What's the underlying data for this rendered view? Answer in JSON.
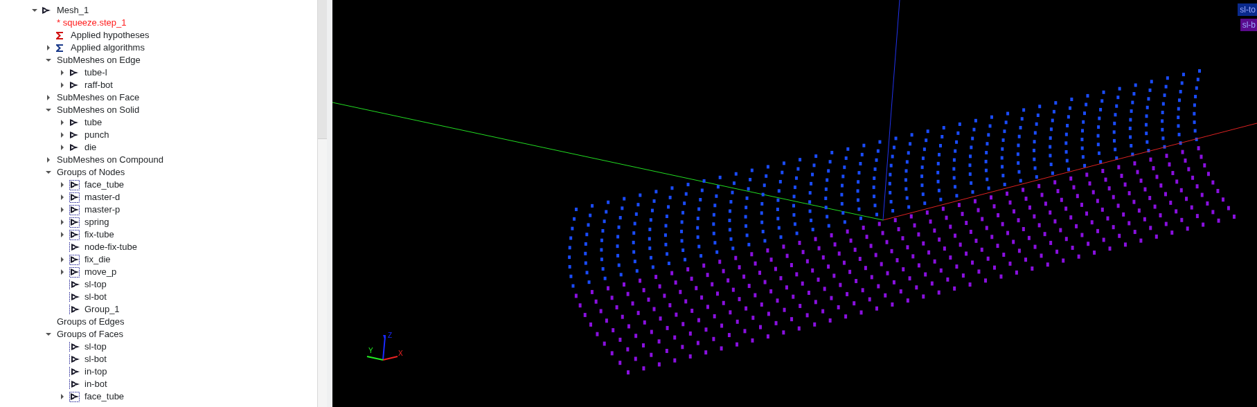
{
  "tree": [
    {
      "label": "Mesh_1",
      "kind": "mesh",
      "expanded": true,
      "children": [
        {
          "label": "* squeeze.step_1",
          "kind": "modified"
        },
        {
          "label": "Applied hypotheses",
          "kind": "hypothesis"
        },
        {
          "label": "Applied algorithms",
          "kind": "algorithm",
          "expanded": false
        },
        {
          "label": "SubMeshes on Edge",
          "kind": "folder",
          "expanded": true,
          "children": [
            {
              "label": "tube-l",
              "kind": "mesh",
              "expanded": false
            },
            {
              "label": "raff-bot",
              "kind": "mesh",
              "expanded": false
            }
          ]
        },
        {
          "label": "SubMeshes on Face",
          "kind": "folder",
          "expanded": false
        },
        {
          "label": "SubMeshes on Solid",
          "kind": "folder",
          "expanded": true,
          "children": [
            {
              "label": "tube",
              "kind": "mesh",
              "expanded": false
            },
            {
              "label": "punch",
              "kind": "mesh",
              "expanded": false
            },
            {
              "label": "die",
              "kind": "mesh",
              "expanded": false
            }
          ]
        },
        {
          "label": "SubMeshes on Compound",
          "kind": "folder",
          "expanded": false
        },
        {
          "label": "Groups of Nodes",
          "kind": "folder",
          "expanded": true,
          "children": [
            {
              "label": "face_tube",
              "kind": "group",
              "expanded": false
            },
            {
              "label": "master-d",
              "kind": "group",
              "expanded": false
            },
            {
              "label": "master-p",
              "kind": "group",
              "expanded": false
            },
            {
              "label": "spring",
              "kind": "group",
              "expanded": false
            },
            {
              "label": "fix-tube",
              "kind": "group",
              "expanded": false
            },
            {
              "label": "node-fix-tube",
              "kind": "item"
            },
            {
              "label": "fix_die",
              "kind": "group",
              "expanded": false
            },
            {
              "label": "move_p",
              "kind": "group",
              "expanded": false
            },
            {
              "label": "sl-top",
              "kind": "item"
            },
            {
              "label": "sl-bot",
              "kind": "item"
            },
            {
              "label": "Group_1",
              "kind": "item"
            }
          ]
        },
        {
          "label": "Groups of Edges",
          "kind": "folder"
        },
        {
          "label": "Groups of Faces",
          "kind": "folder",
          "expanded": true,
          "children": [
            {
              "label": "sl-top",
              "kind": "item"
            },
            {
              "label": "sl-bot",
              "kind": "item"
            },
            {
              "label": "in-top",
              "kind": "item"
            },
            {
              "label": "in-bot",
              "kind": "item"
            },
            {
              "label": "face_tube",
              "kind": "group",
              "expanded": false
            }
          ]
        }
      ]
    }
  ],
  "viewer": {
    "legend": [
      {
        "label": "sl-to",
        "color": "#0a2a8c"
      },
      {
        "label": "sl-b",
        "color": "#5a0a8c"
      }
    ],
    "triad": {
      "x": "X",
      "y": "Y",
      "z": "Z"
    }
  }
}
